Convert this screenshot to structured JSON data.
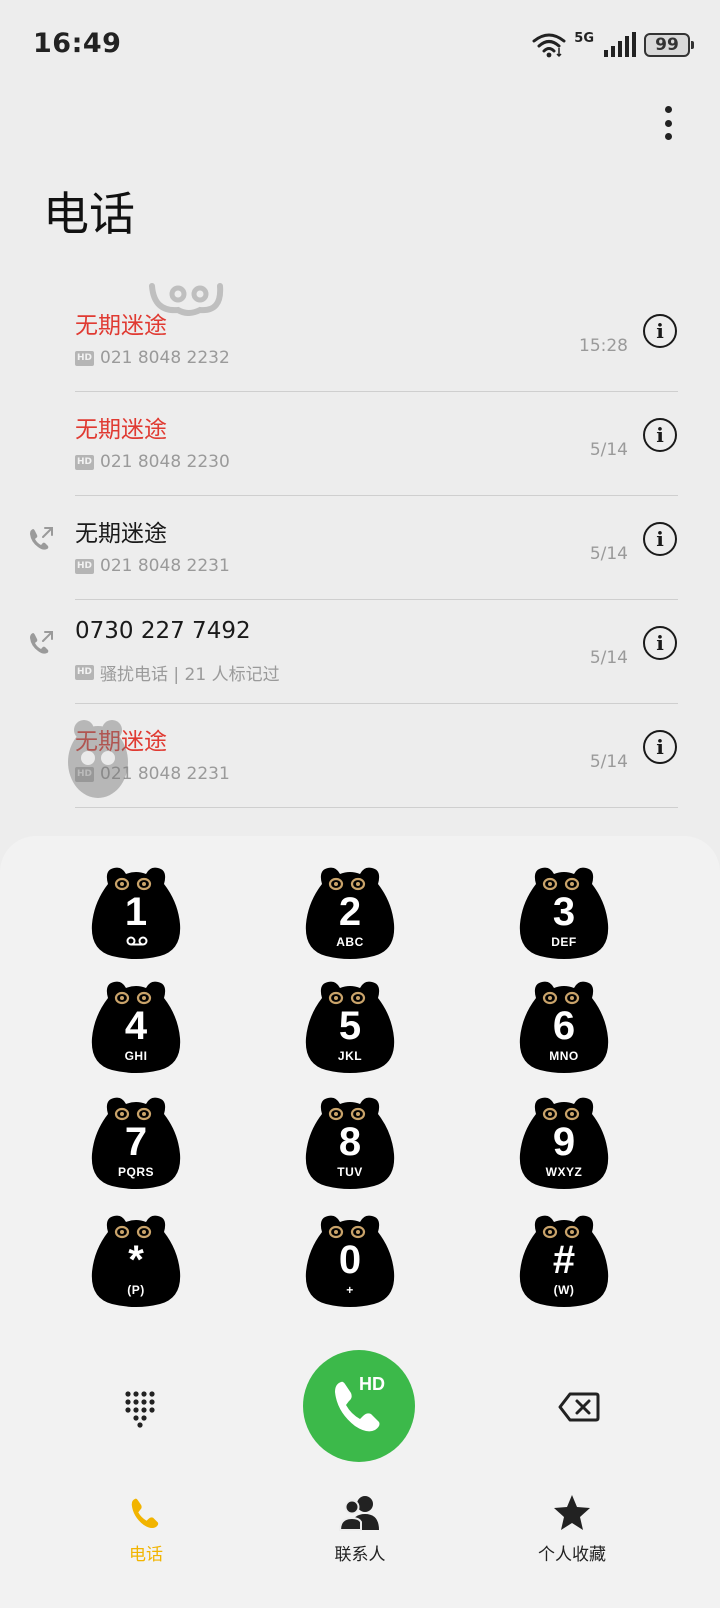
{
  "status_bar": {
    "time": "16:49",
    "network": "5G",
    "battery": "99"
  },
  "header": {
    "title": "电话",
    "menu_icon": "more-vertical-icon"
  },
  "call_log": [
    {
      "name": "无期迷途",
      "missed": true,
      "direction": "none",
      "hd": "HD",
      "detail": "021 8048 2232",
      "time": "15:28"
    },
    {
      "name": "无期迷途",
      "missed": true,
      "direction": "none",
      "hd": "HD",
      "detail": "021 8048 2230",
      "time": "5/14"
    },
    {
      "name": "无期迷途",
      "missed": false,
      "direction": "outgoing",
      "hd": "HD",
      "detail": "021 8048 2231",
      "time": "5/14"
    },
    {
      "name": "0730 227 7492",
      "missed": false,
      "direction": "outgoing",
      "hd": "HD",
      "detail": "骚扰电话 | 21 人标记过",
      "time": "5/14"
    },
    {
      "name": "无期迷途",
      "missed": true,
      "direction": "none",
      "hd": "HD",
      "detail": "021 8048 2231",
      "time": "5/14"
    }
  ],
  "dialpad": {
    "keys": [
      {
        "digit": "1",
        "letters": "",
        "voicemail": true
      },
      {
        "digit": "2",
        "letters": "ABC"
      },
      {
        "digit": "3",
        "letters": "DEF"
      },
      {
        "digit": "4",
        "letters": "GHI"
      },
      {
        "digit": "5",
        "letters": "JKL"
      },
      {
        "digit": "6",
        "letters": "MNO"
      },
      {
        "digit": "7",
        "letters": "PQRS"
      },
      {
        "digit": "8",
        "letters": "TUV"
      },
      {
        "digit": "9",
        "letters": "WXYZ"
      },
      {
        "digit": "*",
        "letters": "(P)"
      },
      {
        "digit": "0",
        "letters": "+"
      },
      {
        "digit": "#",
        "letters": "(W)"
      }
    ],
    "call_button_badge": "HD",
    "call_color": "#3cb94a"
  },
  "bottom_nav": {
    "items": [
      {
        "label": "电话",
        "icon": "phone-icon",
        "active": true
      },
      {
        "label": "联系人",
        "icon": "contacts-icon",
        "active": false
      },
      {
        "label": "个人收藏",
        "icon": "star-icon",
        "active": false
      }
    ],
    "active_color": "#f2b400"
  }
}
